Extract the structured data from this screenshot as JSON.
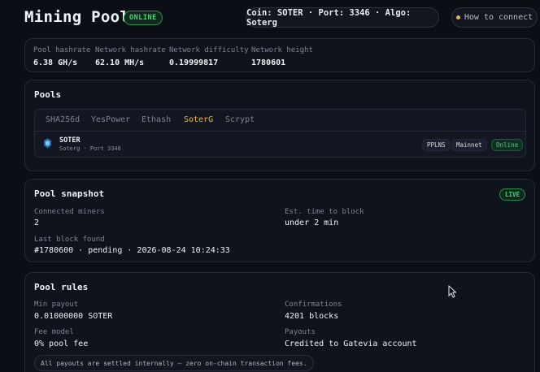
{
  "header": {
    "title": "Mining Pool",
    "status_badge": "ONLINE",
    "coin_info": "Coin: SOTER · Port: 3346 · Algo: Soterg",
    "connect_label": "How to connect"
  },
  "stats": [
    {
      "label": "Pool hashrate",
      "value": "6.38 GH/s"
    },
    {
      "label": "Network hashrate",
      "value": "62.10 MH/s"
    },
    {
      "label": "Network difficulty",
      "value": "0.19999817"
    },
    {
      "label": "Network height",
      "value": "1780601"
    }
  ],
  "pools": {
    "title": "Pools",
    "tabs": [
      "SHA256d",
      "YesPower",
      "Ethash",
      "SoterG",
      "Scrypt"
    ],
    "active_tab": "SoterG",
    "row": {
      "name": "SOTER",
      "subtitle": "Soterg · Port 3346",
      "chips": [
        "PPLNS",
        "Mainnet",
        "Online"
      ]
    }
  },
  "snapshot": {
    "title": "Pool snapshot",
    "badge": "LIVE",
    "connected_miners_label": "Connected miners",
    "connected_miners_value": "2",
    "est_time_label": "Est. time to block",
    "est_time_value": "under 2 min",
    "last_block_label": "Last block found",
    "last_block_value": "#1780600 · pending · 2026-08-24 10:24:33"
  },
  "rules": {
    "title": "Pool rules",
    "min_payout_label": "Min payout",
    "min_payout_value": "0.01000000 SOTER",
    "confirmations_label": "Confirmations",
    "confirmations_value": "4201 blocks",
    "fee_label": "Fee model",
    "fee_value": "0% pool fee",
    "payouts_label": "Payouts",
    "payouts_value": "Credited to Gatevia account",
    "notice": "All payouts are settled internally — zero on-chain transaction fees."
  },
  "colors": {
    "accent": "#f3b53a",
    "online_green": "#46d17a",
    "background": "#0b0e14",
    "card": "#0f131b"
  },
  "icons": {
    "coin": "soter-coin-icon",
    "status_dot": "amber-dot-icon",
    "cursor": "mouse-pointer-icon"
  }
}
